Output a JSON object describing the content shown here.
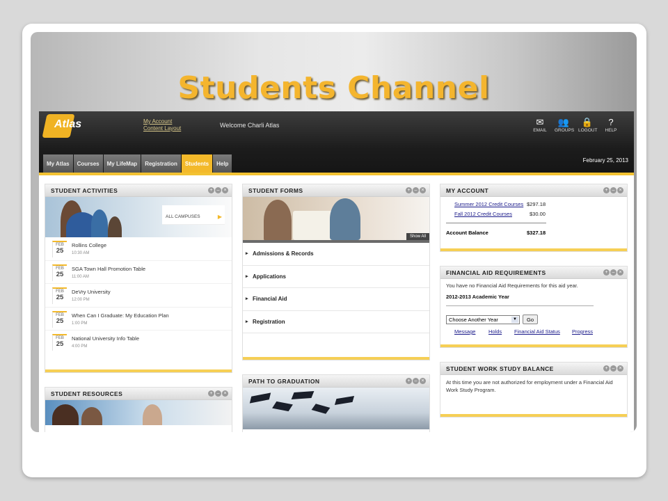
{
  "slide_title": "Students Channel",
  "portal": {
    "logo_text": "Atlas",
    "account_links": [
      "My Account",
      "Content Layout"
    ],
    "welcome": "Welcome Charli Atlas",
    "tools": [
      {
        "icon": "email-icon",
        "glyph": "✉",
        "label": "EMAIL"
      },
      {
        "icon": "groups-icon",
        "glyph": "👥",
        "label": "GROUPS"
      },
      {
        "icon": "lock-icon",
        "glyph": "🔒",
        "label": "LOGOUT"
      },
      {
        "icon": "help-icon",
        "glyph": "?",
        "label": "HELP"
      }
    ],
    "tabs": [
      "My Atlas",
      "Courses",
      "My LifeMap",
      "Registration",
      "Students",
      "Help"
    ],
    "active_tab": "Students",
    "date": "February 25, 2013",
    "accent_color": "#f3b92a"
  },
  "student_activities": {
    "title": "STUDENT ACTIVITIES",
    "campus_label": "ALL CAMPUSES",
    "events": [
      {
        "month": "FEB",
        "day": "25",
        "title": "Rollins College",
        "time": "10:30 AM"
      },
      {
        "month": "FEB",
        "day": "25",
        "title": "SGA Town Hall Promotion Table",
        "time": "11:00 AM"
      },
      {
        "month": "FEB",
        "day": "25",
        "title": "DeVry University",
        "time": "12:00 PM"
      },
      {
        "month": "FEB",
        "day": "25",
        "title": "When Can I Graduate: My Education Plan",
        "time": "1:00 PM"
      },
      {
        "month": "FEB",
        "day": "25",
        "title": "National University Info Table",
        "time": "4:00 PM"
      }
    ]
  },
  "student_resources": {
    "title": "STUDENT RESOURCES"
  },
  "student_forms": {
    "title": "STUDENT FORMS",
    "show_all": "Show All",
    "items": [
      "Admissions & Records",
      "Applications",
      "Financial Aid",
      "Registration"
    ]
  },
  "path_to_graduation": {
    "title": "PATH TO GRADUATION"
  },
  "my_account": {
    "title": "MY ACCOUNT",
    "rows": [
      {
        "label": "Summer 2012 Credit Courses",
        "amount": "$297.18"
      },
      {
        "label": "Fall 2012 Credit Courses",
        "amount": "$30.00"
      }
    ],
    "balance_label": "Account Balance",
    "balance": "$327.18"
  },
  "financial_aid": {
    "title": "FINANCIAL AID REQUIREMENTS",
    "message": "You have no Financial Aid Requirements for this aid year.",
    "year": "2012-2013 Academic Year",
    "select_value": "Choose Another Year",
    "go_label": "Go",
    "links": [
      "Message",
      "Holds",
      "Financial Aid Status",
      "Progress"
    ]
  },
  "work_study": {
    "title": "STUDENT WORK STUDY BALANCE",
    "message": "At this time you are not authorized for employment under a Financial Aid Work Study Program."
  }
}
